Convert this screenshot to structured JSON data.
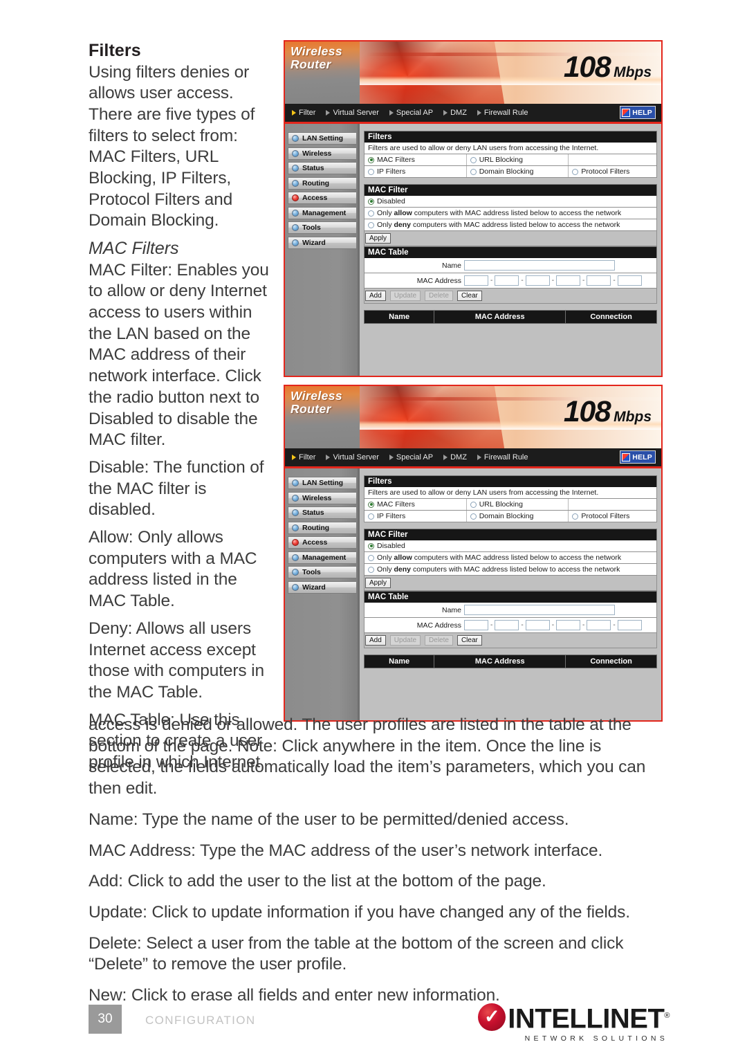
{
  "document": {
    "heading": "Filters",
    "intro": "Using filters denies or allows user access. There are five types of filters to select from: MAC Filters, URL Blocking, IP Filters, Protocol Filters and Domain Blocking.",
    "subheading": "MAC Filters",
    "paragraphs_left": [
      "MAC Filter: Enables you to allow or deny Internet access to users within the LAN based on the MAC address of their network interface. Click the radio button next to Disabled to disable the MAC filter.",
      "Disable: The function of the MAC filter is disabled.",
      "Allow: Only allows computers with a MAC address listed in the MAC Table.",
      "Deny: Allows all users Internet access except those with computers in the MAC Table.",
      "MAC Table: Use this section to create a user profile in which Internet"
    ],
    "paragraphs_bottom": [
      "access is denied or allowed. The user profiles are listed in the table at the bottom of the page. Note: Click anywhere in the item. Once the line is selected, the fields automatically load the item’s parameters, which you can then edit.",
      "Name: Type the name of the user to be permitted/denied access.",
      "MAC Address: Type the MAC address of the user’s network interface.",
      "Add: Click to add the user to the list at the bottom of the page.",
      "Update: Click to update information if you have changed any of the fields.",
      "Delete: Select a user from the table at the bottom of the screen and click “Delete” to remove the user profile.",
      "New: Click to erase all fields and enter new information."
    ]
  },
  "footer": {
    "page_number": "30",
    "section_label": "CONFIGURATION",
    "logo_name": "INTELLINET",
    "logo_tm": "®",
    "logo_tagline": "NETWORK SOLUTIONS",
    "logo_color": "#c8102e"
  },
  "screenshot": {
    "brand_line1": "Wireless",
    "brand_line2": "Router",
    "speed_number": "108",
    "speed_unit": "Mbps",
    "help_label": "HELP",
    "nav": [
      {
        "label": "Filter",
        "active": true
      },
      {
        "label": "Virtual Server",
        "active": false
      },
      {
        "label": "Special AP",
        "active": false
      },
      {
        "label": "DMZ",
        "active": false
      },
      {
        "label": "Firewall Rule",
        "active": false
      }
    ],
    "sidebar": [
      {
        "label": "LAN Setting",
        "active": false
      },
      {
        "label": "Wireless",
        "active": false
      },
      {
        "label": "Status",
        "active": false
      },
      {
        "label": "Routing",
        "active": false
      },
      {
        "label": "Access",
        "active": true
      },
      {
        "label": "Management",
        "active": false
      },
      {
        "label": "Tools",
        "active": false
      },
      {
        "label": "Wizard",
        "active": false
      }
    ],
    "filters_section": {
      "title": "Filters",
      "description": "Filters are used to allow or deny LAN users from accessing the Internet.",
      "options_row1": [
        {
          "label": "MAC Filters",
          "selected": true
        },
        {
          "label": "URL Blocking",
          "selected": false
        }
      ],
      "options_row2": [
        {
          "label": "IP Filters",
          "selected": false
        },
        {
          "label": "Domain Blocking",
          "selected": false
        },
        {
          "label": "Protocol Filters",
          "selected": false
        }
      ]
    },
    "mac_filter_section": {
      "title": "MAC Filter",
      "option_disabled": "Disabled",
      "option_allow_prefix": "Only ",
      "option_allow_bold": "allow",
      "option_allow_suffix": " computers with MAC address listed below to access the network",
      "option_deny_prefix": "Only ",
      "option_deny_bold": "deny",
      "option_deny_suffix": " computers with MAC address listed below to access the network",
      "selected": "Disabled",
      "apply_label": "Apply"
    },
    "mac_table_section": {
      "title": "MAC Table",
      "name_label": "Name",
      "name_value": "",
      "mac_label": "MAC Address",
      "mac_octets": [
        "",
        "",
        "",
        "",
        "",
        ""
      ],
      "separator": "-",
      "buttons": [
        {
          "label": "Add",
          "disabled": false
        },
        {
          "label": "Update",
          "disabled": true
        },
        {
          "label": "Delete",
          "disabled": true
        },
        {
          "label": "Clear",
          "disabled": false
        }
      ],
      "table_headers": [
        "Name",
        "MAC Address",
        "Connection"
      ]
    }
  }
}
